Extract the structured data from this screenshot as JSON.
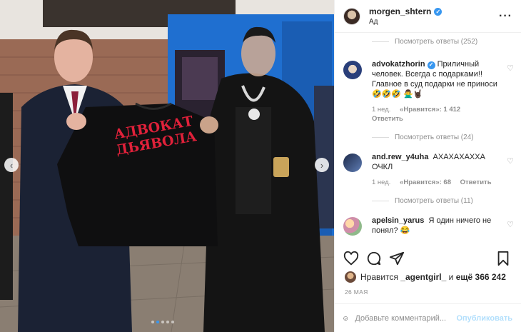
{
  "post": {
    "author": "morgen_shtern",
    "subtitle": "Ад",
    "more_icon": "ellipsis-icon",
    "photo": {
      "sweatshirt_text_line1": "АДВОКАТ",
      "sweatshirt_text_line2": "ДЬЯВОЛА",
      "carousel_count": 5,
      "carousel_active": 1
    }
  },
  "comments": {
    "replies_top": "Посмотреть ответы (252)",
    "items": [
      {
        "user": "advokatzhorin",
        "verified": true,
        "text": "Приличный человек. Всегда с подарками!! Главное в суд подарки не приноси 🤣🤣🤣 🙅‍♂️🤘🏿",
        "time": "1 нед.",
        "likes": "«Нравится»: 1 412",
        "reply": "Ответить",
        "replies": "Посмотреть ответы (24)"
      },
      {
        "user": "and.rew_y4uha",
        "verified": false,
        "text": "АХАХАХАХХА ОЧКЛ",
        "time": "1 нед.",
        "likes": "«Нравится»: 68",
        "reply": "Ответить",
        "replies": "Посмотреть ответы (11)"
      },
      {
        "user": "apelsin_yarus",
        "verified": false,
        "text": "Я один ничего не понял? 😂"
      }
    ]
  },
  "likes": {
    "prefix": "Нравится",
    "user": "_agentgirl_",
    "middle": "и",
    "count": "ещё 366 242"
  },
  "date": "26 МАЯ",
  "add_comment": {
    "placeholder": "Добавьте комментарий...",
    "publish_label": "Опубликовать"
  },
  "colors": {
    "accent": "#3897f0",
    "publish_disabled": "#b2dffc",
    "sweatshirt_text": "#e0213a",
    "door_blue": "#1f6fd0"
  }
}
